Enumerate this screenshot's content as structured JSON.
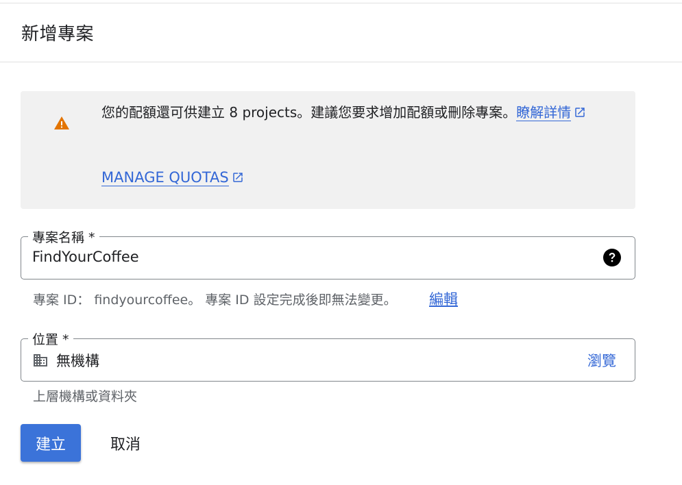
{
  "header": {
    "title": "新增專案"
  },
  "notice": {
    "message": "您的配額還可供建立 8 projects。建議您要求增加配額或刪除專案。",
    "learn_more": "瞭解詳情",
    "manage_quotas": "MANAGE QUOTAS"
  },
  "project_name": {
    "label": "專案名稱 *",
    "value": "FindYourCoffee",
    "hint": "專案 ID： findyourcoffee。 專案 ID 設定完成後即無法變更。",
    "edit_label": "編輯"
  },
  "location": {
    "label": "位置 *",
    "value": "無機構",
    "browse_label": "瀏覽",
    "hint": "上層機構或資料夾"
  },
  "actions": {
    "create_label": "建立",
    "cancel_label": "取消"
  },
  "colors": {
    "accent": "#3367d6",
    "primary_button": "#3b73d9",
    "warning": "#e37400",
    "notice_bg": "#f1f1f1"
  },
  "icons": {
    "warning": "warning-triangle-icon",
    "external": "open-in-new-icon",
    "help": "help-circle-icon",
    "org": "organization-building-icon"
  }
}
